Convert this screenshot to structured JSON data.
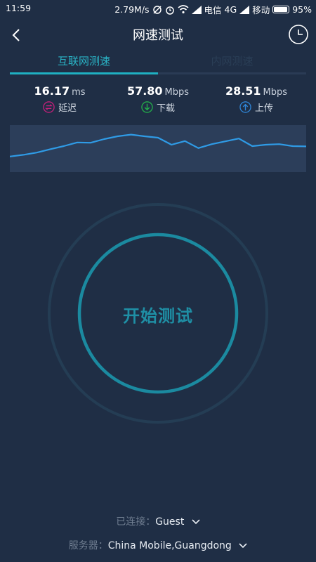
{
  "status_bar": {
    "time": "11:59",
    "net_speed": "2.79M/s",
    "carrier1": "电信",
    "network_type": "4G",
    "carrier2": "移动",
    "battery": "95%"
  },
  "header": {
    "title": "网速测试"
  },
  "tabs": [
    {
      "label": "互联网测速",
      "active": true
    },
    {
      "label": "内网测速",
      "active": false
    }
  ],
  "metrics": {
    "latency": {
      "value": "16.17",
      "unit": "ms",
      "label": "延迟",
      "color": "#c2207a"
    },
    "download": {
      "value": "57.80",
      "unit": "Mbps",
      "label": "下载",
      "color": "#23b04a"
    },
    "upload": {
      "value": "28.51",
      "unit": "Mbps",
      "label": "上传",
      "color": "#2f86d8"
    }
  },
  "speed_trace": [
    0.92,
    0.86,
    0.78,
    0.66,
    0.55,
    0.42,
    0.43,
    0.3,
    0.2,
    0.14,
    0.2,
    0.25,
    0.5,
    0.37,
    0.62,
    0.48,
    0.38,
    0.28,
    0.55,
    0.5,
    0.48,
    0.55,
    0.56
  ],
  "start_button": {
    "label": "开始测试"
  },
  "footer": {
    "connected_label": "已连接：",
    "connected_value": "Guest",
    "server_label": "服务器：",
    "server_value": "China Mobile,Guangdong"
  },
  "colors": {
    "background": "#1f2e45",
    "accent": "#1fb0c2",
    "graph_line": "#2f9be6"
  }
}
